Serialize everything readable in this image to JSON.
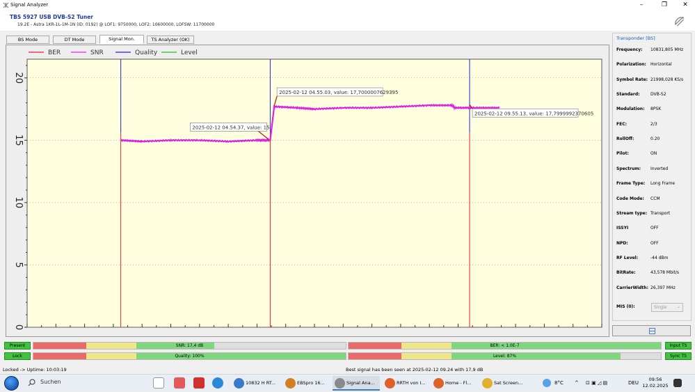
{
  "window": {
    "title": "Signal Analyzer"
  },
  "header": {
    "device_name": "TBS 5927 USB DVB-S2 Tuner",
    "device_info": "19.2E - Astra 1KR-1L-1M-1N (ID: 0192) @ LOF1: 9750000, LOF2: 10600000, LOFSW: 11700000"
  },
  "tabs": [
    {
      "label": "BS Mode",
      "active": false
    },
    {
      "label": "DT Mode",
      "active": false
    },
    {
      "label": "Signal Mon.",
      "active": true
    },
    {
      "label": "TS Analyzer (OK)",
      "active": false
    }
  ],
  "chart_data": {
    "type": "line",
    "title": "",
    "xlabel": "",
    "ylabel": "",
    "ylim": [
      0,
      21.5
    ],
    "xlim": [
      0,
      100
    ],
    "y_ticks": [
      0,
      5,
      10,
      15,
      20
    ],
    "grid": true,
    "legend_position": "top-left",
    "legend": [
      {
        "name": "BER",
        "color": "#e8202a"
      },
      {
        "name": "SNR",
        "color": "#e020e0"
      },
      {
        "name": "Quality",
        "color": "#2020d0"
      },
      {
        "name": "Level",
        "color": "#20c020"
      }
    ],
    "series": [
      {
        "name": "SNR",
        "color": "#e020e0",
        "x": [
          16.3,
          20,
          25,
          30,
          35,
          40,
          42.3,
          43,
          47,
          50,
          55,
          60,
          65,
          70,
          73.9,
          74.5,
          78,
          82.2
        ],
        "y": [
          15.0,
          14.9,
          15.0,
          15.0,
          14.9,
          15.0,
          15.0,
          17.7,
          17.6,
          17.5,
          17.6,
          17.6,
          17.7,
          17.8,
          17.8,
          17.6,
          17.6,
          17.6
        ]
      }
    ],
    "markers": [
      {
        "x": 16.3,
        "bottom_color": "#e8202a",
        "top_color": "#2020d0"
      },
      {
        "x": 42.3,
        "bottom_color": "#e8202a",
        "top_color": "#2020d0"
      },
      {
        "x": 77.0,
        "bottom_color": "#e8202a",
        "top_color": "#2020d0"
      }
    ],
    "annotations": [
      {
        "text": "2025-02-12 04.54.37, value: 15",
        "x": 42.3,
        "y": 15
      },
      {
        "text": "2025-02-12 04.55.03, value: 17,7000007629395",
        "x": 43,
        "y": 17.7
      },
      {
        "text": "2025-02-12 09.55.13, value: 17,7999992370605",
        "x": 77.0,
        "y": 17.8
      }
    ],
    "background": "#ffffe0"
  },
  "transponder": {
    "title": "Transponder [BS]",
    "rows": [
      {
        "key": "Frequency:",
        "value": "10831,805 MHz"
      },
      {
        "key": "Polarization:",
        "value": "Horizontal"
      },
      {
        "key": "Symbol Rate:",
        "value": "21998,028 KS/s"
      },
      {
        "key": "Standard:",
        "value": "DVB-S2"
      },
      {
        "key": "Modulation:",
        "value": "8PSK"
      },
      {
        "key": "FEC:",
        "value": "2/3"
      },
      {
        "key": "RollOff:",
        "value": "0.20"
      },
      {
        "key": "Pilot:",
        "value": "ON"
      },
      {
        "key": "Spectrum:",
        "value": "Inverted"
      },
      {
        "key": "Frame Type:",
        "value": "Long Frame"
      },
      {
        "key": "Code Mode:",
        "value": "CCM"
      },
      {
        "key": "Stream type:",
        "value": "Transport"
      },
      {
        "key": "ISSYI",
        "value": "OFF"
      },
      {
        "key": "NPD:",
        "value": "OFF"
      },
      {
        "key": "RF Level:",
        "value": "-44 dBm"
      },
      {
        "key": "BitRate:",
        "value": "43,578 Mbit/s"
      },
      {
        "key": "CarrierWidth:",
        "value": "26,397 MHz"
      }
    ],
    "mis_label": "MIS (0):",
    "mis_value": "Single"
  },
  "status": {
    "present": "Present",
    "lock": "Lock",
    "input_ts": "Input TS",
    "sync_ts": "Sync TS",
    "snr_label": "SNR: 17,4 dB",
    "snr_fraction": 0.58,
    "quality_label": "Quality: 100%",
    "quality_fraction": 1.0,
    "ber_label": "BER: < 1.0E-7",
    "ber_fraction": 1.0,
    "level_label": "Level: 87%",
    "level_fraction": 0.87,
    "colors": {
      "red": "#e86a6a",
      "yellow": "#eee68a",
      "green": "#7fd67f",
      "gray": "#dcdcdc",
      "ok_green": "#43c143"
    }
  },
  "statusbar": {
    "left": "Locked -> Uptime: 10:03:19",
    "center": "Best signal has been seen at 2025-02-12 09.24 with 17,9 dB"
  },
  "taskbar": {
    "search": "Suchen",
    "apps": [
      {
        "label": "10832 H RT...",
        "color": "#3a78c8"
      },
      {
        "label": "EBSpro 16...",
        "color": "#d08020"
      },
      {
        "label": "Signal Ana...",
        "color": "#8a8a8a"
      },
      {
        "label": "RRTH von I...",
        "color": "#e0602a"
      },
      {
        "label": "Home - Fl...",
        "color": "#e0602a"
      },
      {
        "label": "Sat Screen...",
        "color": "#e0b030"
      }
    ],
    "temp": "8°C",
    "lang": "DEU",
    "time": "09:56",
    "date": "12.02.2025"
  }
}
